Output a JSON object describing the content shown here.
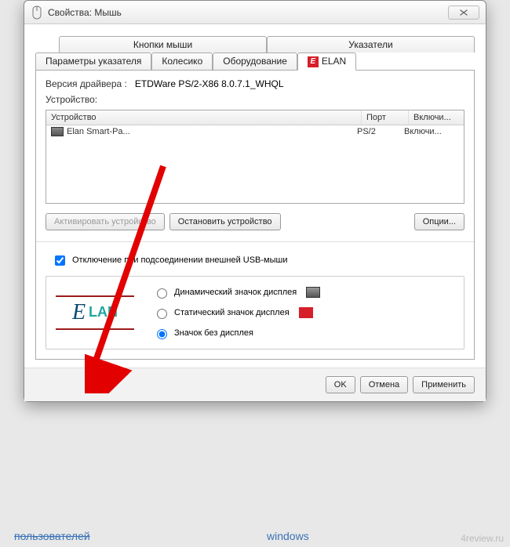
{
  "window": {
    "title": "Свойства: Мышь"
  },
  "tabs": {
    "upper": [
      {
        "label": "Кнопки мыши"
      },
      {
        "label": "Указатели"
      }
    ],
    "lower": [
      {
        "label": "Параметры указателя"
      },
      {
        "label": "Колесико"
      },
      {
        "label": "Оборудование"
      },
      {
        "label": "ELAN"
      }
    ]
  },
  "driver": {
    "label": "Версия драйвера :",
    "value": "ETDWare PS/2-X86 8.0.7.1_WHQL"
  },
  "device_label": "Устройство:",
  "device_table": {
    "headers": {
      "device": "Устройство",
      "port": "Порт",
      "enabled": "Включи..."
    },
    "rows": [
      {
        "device": "Elan Smart-Pa...",
        "port": "PS/2",
        "enabled": "Включи..."
      }
    ]
  },
  "buttons": {
    "activate": "Активировать устройство",
    "stop": "Остановить устройство",
    "options": "Опции..."
  },
  "checkbox": {
    "label": "Отключение при подсоединении внешней USB-мыши",
    "checked": true
  },
  "icon_mode": {
    "options": [
      {
        "label": "Динамический значок дисплея",
        "key": "dynamic"
      },
      {
        "label": "Статический значок дисплея",
        "key": "static"
      },
      {
        "label": "Значок без дисплея",
        "key": "none"
      }
    ],
    "selected": "none"
  },
  "footer": {
    "ok": "OK",
    "cancel": "Отмена",
    "apply": "Применить"
  },
  "watermark": "4review.ru",
  "bg": {
    "left": "пользователей",
    "right": "windows"
  },
  "elan_logo": {
    "script": "E",
    "rest": "LAN"
  }
}
